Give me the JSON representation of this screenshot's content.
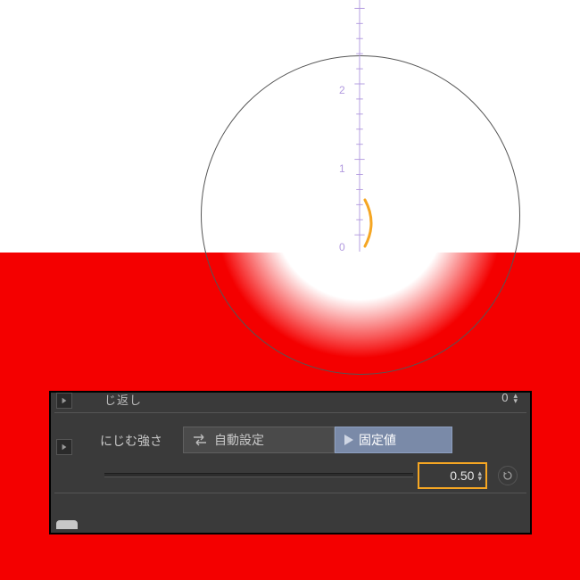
{
  "canvas": {
    "ruler_labels": {
      "zero": "0",
      "one": "1",
      "two": "2"
    }
  },
  "panel": {
    "truncated_label": "じ返し",
    "truncated_value": "0",
    "bleed": {
      "label": "にじむ強さ",
      "auto_label": "自動設定",
      "fixed_label": "固定値",
      "value": "0.50"
    }
  }
}
